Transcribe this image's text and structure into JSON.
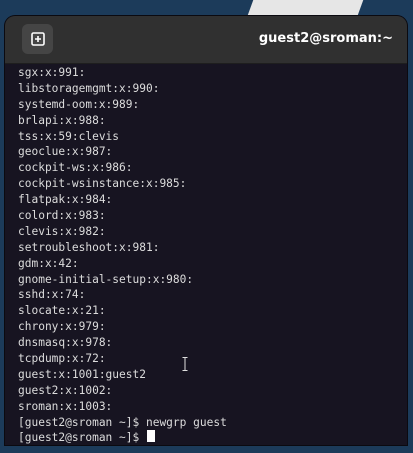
{
  "window": {
    "title": "guest2@sroman:~"
  },
  "icons": {
    "new_tab": "new-tab-icon",
    "mouse_cursor": "text-cursor-icon"
  },
  "colors": {
    "titlebar": "#303030",
    "terminal_bg": "#171421",
    "terminal_fg": "#dcdcdc",
    "title_text": "#ffffff"
  },
  "terminal": {
    "lines": [
      "sgx:x:991:",
      "libstoragemgmt:x:990:",
      "systemd-oom:x:989:",
      "brlapi:x:988:",
      "tss:x:59:clevis",
      "geoclue:x:987:",
      "cockpit-ws:x:986:",
      "cockpit-wsinstance:x:985:",
      "flatpak:x:984:",
      "colord:x:983:",
      "clevis:x:982:",
      "setroubleshoot:x:981:",
      "gdm:x:42:",
      "gnome-initial-setup:x:980:",
      "sshd:x:74:",
      "slocate:x:21:",
      "chrony:x:979:",
      "dnsmasq:x:978:",
      "tcpdump:x:72:",
      "guest:x:1001:guest2",
      "guest2:x:1002:",
      "sroman:x:1003:",
      "[guest2@sroman ~]$ newgrp guest"
    ],
    "prompt": "[guest2@sroman ~]$ "
  }
}
